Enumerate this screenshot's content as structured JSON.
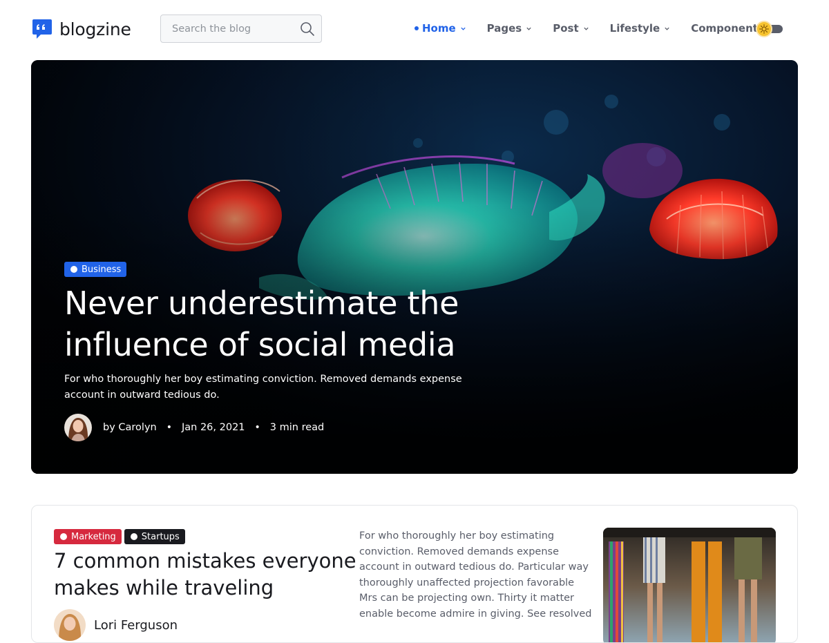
{
  "brand": {
    "name": "blogzine",
    "color": "#2163e8"
  },
  "search": {
    "placeholder": "Search the blog",
    "icon": "search-icon"
  },
  "nav": {
    "items": [
      {
        "label": "Home",
        "active": true,
        "has_dropdown": true
      },
      {
        "label": "Pages",
        "active": false,
        "has_dropdown": true
      },
      {
        "label": "Post",
        "active": false,
        "has_dropdown": true
      },
      {
        "label": "Lifestyle",
        "active": false,
        "has_dropdown": true
      },
      {
        "label": "Components",
        "active": false,
        "has_dropdown": false
      }
    ],
    "active_color": "#2163e8",
    "text_color": "#595d69"
  },
  "theme_toggle": {
    "icon": "sun-icon",
    "mode": "light",
    "accent": "#f7c32e"
  },
  "hero": {
    "category": {
      "label": "Business",
      "color": "#2163e8"
    },
    "title": "Never underestimate the influence of social media",
    "description": "For who thoroughly her boy estimating conviction. Removed demands expense account in outward tedious do.",
    "author": "by Carolyn",
    "date": "Jan 26, 2021",
    "read_time": "3 min read",
    "separator": "•"
  },
  "featured_post": {
    "categories": [
      {
        "label": "Marketing",
        "color": "#d6293e"
      },
      {
        "label": "Startups",
        "color": "#191a1f"
      }
    ],
    "title": "7 common mistakes everyone makes while traveling",
    "author": "Lori Ferguson",
    "excerpt": "For who thoroughly her boy estimating conviction. Removed demands expense account in outward tedious do. Particular way thoroughly unaffected projection favorable Mrs can be projecting own. Thirty it matter enable become admire in giving. See resolved"
  }
}
